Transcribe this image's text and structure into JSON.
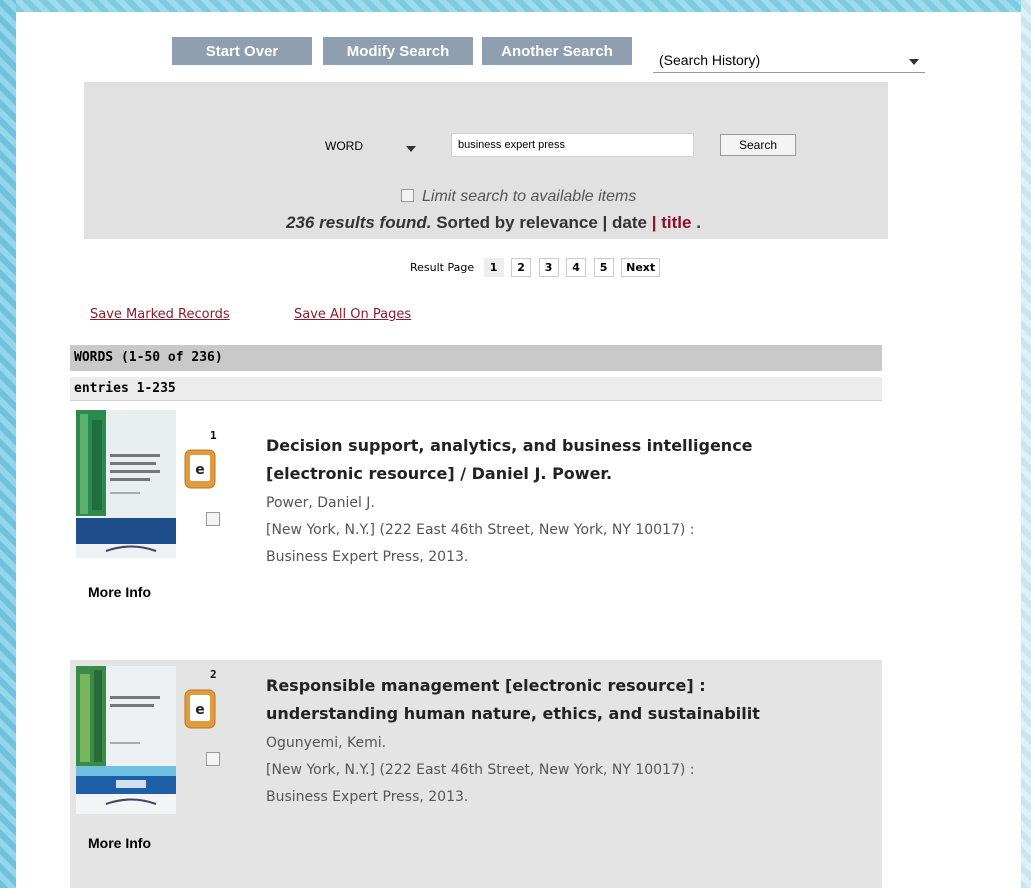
{
  "toolbar": {
    "start_over": "Start Over",
    "modify_search": "Modify Search",
    "another_search": "Another Search",
    "history_select": "(Search History)"
  },
  "search": {
    "field": "WORD",
    "query": "business expert press",
    "button": "Search",
    "limit_label": "Limit search to available items",
    "results_count": "236 results found.",
    "sorted_by": "Sorted by",
    "sort_relevance": "relevance",
    "sort_date": "date",
    "sort_title": "title"
  },
  "pager": {
    "label": "Result Page",
    "pages": [
      "1",
      "2",
      "3",
      "4",
      "5"
    ],
    "next": "Next"
  },
  "actions": {
    "save_marked": "Save Marked Records",
    "save_all": "Save All On Pages"
  },
  "list": {
    "header": "WORDS (1-50 of 236)",
    "entries": "entries 1-235"
  },
  "records": [
    {
      "number": "1",
      "title_line1": "Decision support, analytics, and business intelligence",
      "title_line2": "[electronic resource] / Daniel J. Power.",
      "author": "Power, Daniel J.",
      "pub_line1": "[New York, N.Y.] (222 East 46th Street, New York, NY 10017) :",
      "pub_line2": "Business Expert Press, 2013.",
      "more_info": "More Info",
      "cover_title": "Decision Support, Analytics, and Business Intelligence"
    },
    {
      "number": "2",
      "title_line1": "Responsible management [electronic resource] :",
      "title_line2": "understanding human nature, ethics, and sustainabilit",
      "author": "Ogunyemi, Kemi.",
      "pub_line1": "[New York, N.Y.] (222 East 46th Street, New York, NY 10017) :",
      "pub_line2": "Business Expert Press, 2013.",
      "more_info": "More Info",
      "cover_title": "Responsible Management"
    }
  ],
  "icons": {
    "ebook": "e",
    "colors": {
      "accent_link": "#8b1c2e",
      "toolbar_button": "#8f9fb0",
      "ebook_orange": "#e29a3c"
    }
  }
}
